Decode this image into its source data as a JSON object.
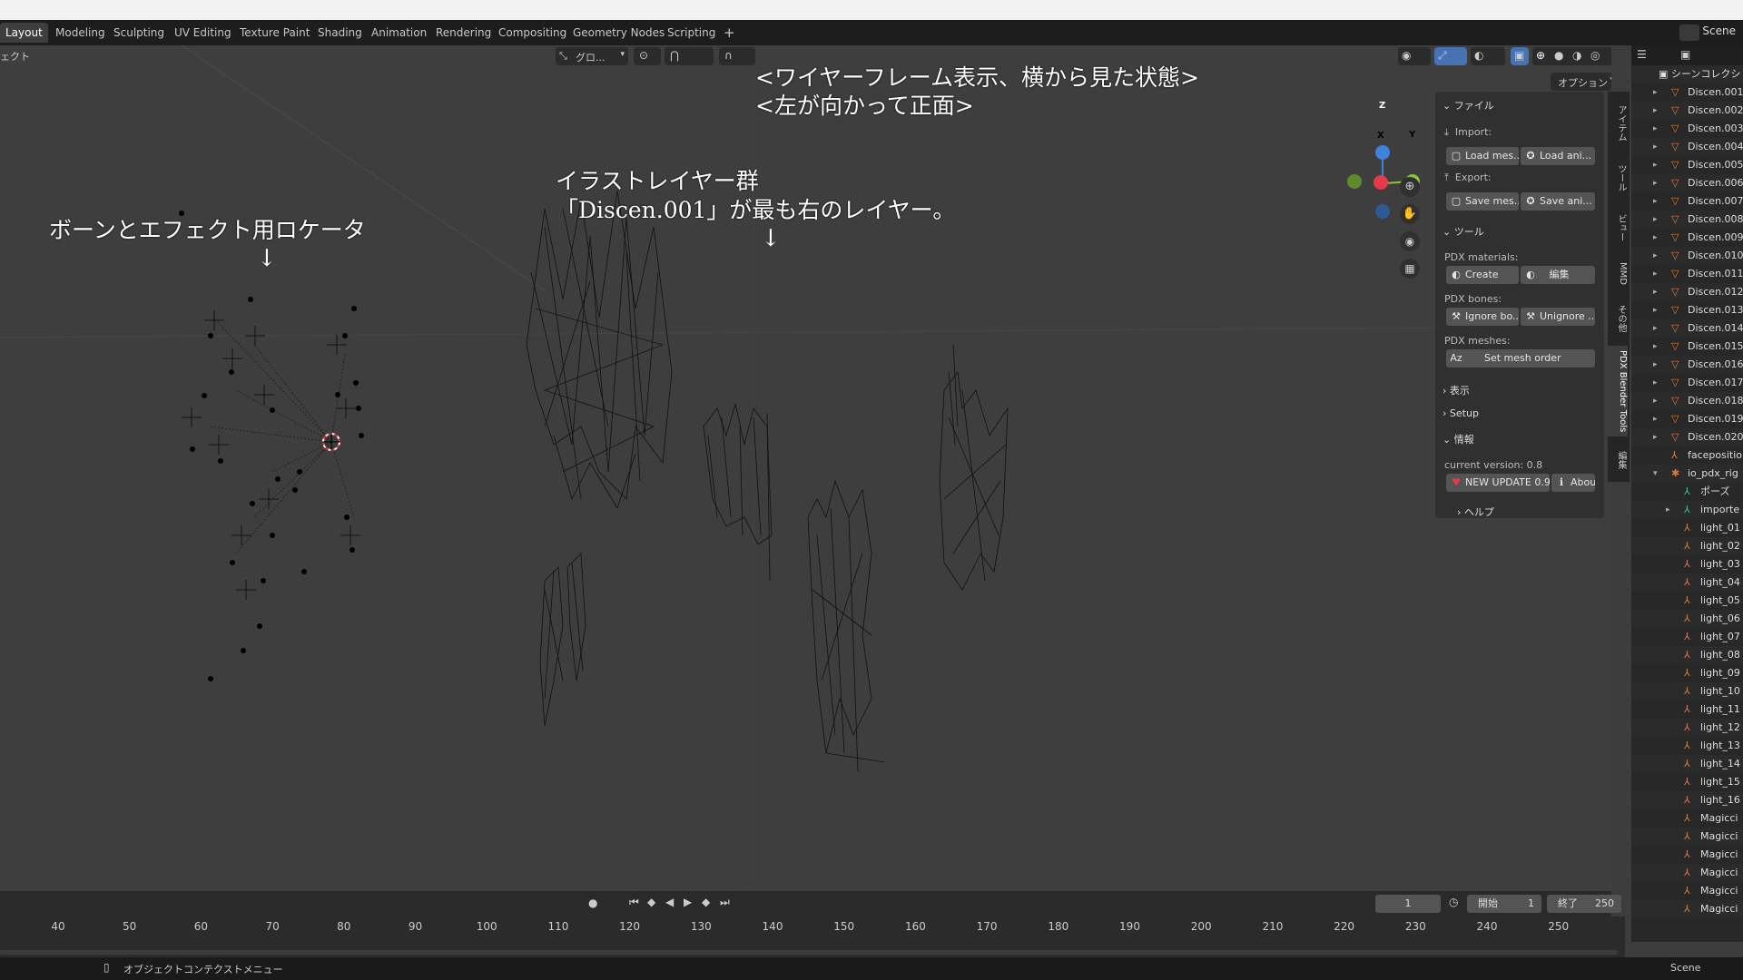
{
  "menubar": {
    "tabs": [
      "Layout",
      "Modeling",
      "Sculpting",
      "UV Editing",
      "Texture Paint",
      "Shading",
      "Animation",
      "Rendering",
      "Compositing",
      "Geometry Nodes",
      "Scripting"
    ],
    "add_tab": "+",
    "scene": "Scene"
  },
  "viewport": {
    "mode_label": "ェクト",
    "transform_orientation": "グロ...",
    "options_label": "オプション"
  },
  "annotations": {
    "wireframe_line1": "<ワイヤーフレーム表示、横から見た状態>",
    "wireframe_line2": "<左が向かって正面>",
    "illust_line1": "イラストレイヤー群",
    "illust_line2": "「Discen.001」が最も右のレイヤー。",
    "bones_label": "ボーンとエフェクト用ロケータ",
    "arrow": "↓"
  },
  "gizmo": {
    "z": "Z",
    "x": "X",
    "y": "Y"
  },
  "npanel": {
    "file_header": "ファイル",
    "import_label": "Import:",
    "load_mesh": "Load mes...",
    "load_anim": "Load ani...",
    "export_label": "Export:",
    "save_mesh": "Save mes...",
    "save_anim": "Save ani...",
    "tools_header": "ツール",
    "materials_label": "PDX materials:",
    "create": "Create",
    "edit": "編集",
    "bones_label": "PDX bones:",
    "ignore_bones": "Ignore bo...",
    "unignore": "Unignore ...",
    "meshes_label": "PDX meshes:",
    "set_mesh_order": "Set mesh order",
    "display_header": "表示",
    "setup_header": "Setup",
    "info_header": "情報",
    "current_version": "current version: 0.8",
    "new_update": "NEW UPDATE 0.9",
    "about": "About",
    "help": "ヘルプ"
  },
  "vtabs": [
    "アイテム",
    "ツール",
    "ビュー",
    "MMD",
    "その他",
    "PDX Blender Tools",
    "編集"
  ],
  "outliner": {
    "root": "シーンコレクシ",
    "items": [
      "Discen.001",
      "Discen.002",
      "Discen.003",
      "Discen.004",
      "Discen.005",
      "Discen.006",
      "Discen.007",
      "Discen.008",
      "Discen.009",
      "Discen.010",
      "Discen.011",
      "Discen.012",
      "Discen.013",
      "Discen.014",
      "Discen.015",
      "Discen.016",
      "Discen.017",
      "Discen.018",
      "Discen.019",
      "Discen.020",
      "faceposition",
      "io_pdx_rig",
      "ポーズ",
      "importe",
      "light_01",
      "light_02",
      "light_03",
      "light_04",
      "light_05",
      "light_06",
      "light_07",
      "light_08",
      "light_09",
      "light_10",
      "light_11",
      "light_12",
      "light_13",
      "light_14",
      "light_15",
      "light_16",
      "Magicci",
      "Magicci",
      "Magicci",
      "Magicci",
      "Magicci",
      "Magicci"
    ],
    "footer": "Scene"
  },
  "timeline": {
    "current_frame": "1",
    "start_label": "開始",
    "start": "1",
    "end_label": "終了",
    "end": "250",
    "ticks": [
      "40",
      "50",
      "60",
      "70",
      "80",
      "90",
      "100",
      "110",
      "120",
      "130",
      "140",
      "150",
      "160",
      "170",
      "180",
      "190",
      "200",
      "210",
      "220",
      "230",
      "240",
      "250"
    ]
  },
  "status": {
    "context_menu": "オブジェクトコンテクストメニュー"
  },
  "colors": {
    "accent": "#4772b3",
    "gizmo_x": "#e8394a",
    "gizmo_y": "#8bc23a",
    "gizmo_z": "#3f82dd",
    "orange": "#e07b39"
  }
}
